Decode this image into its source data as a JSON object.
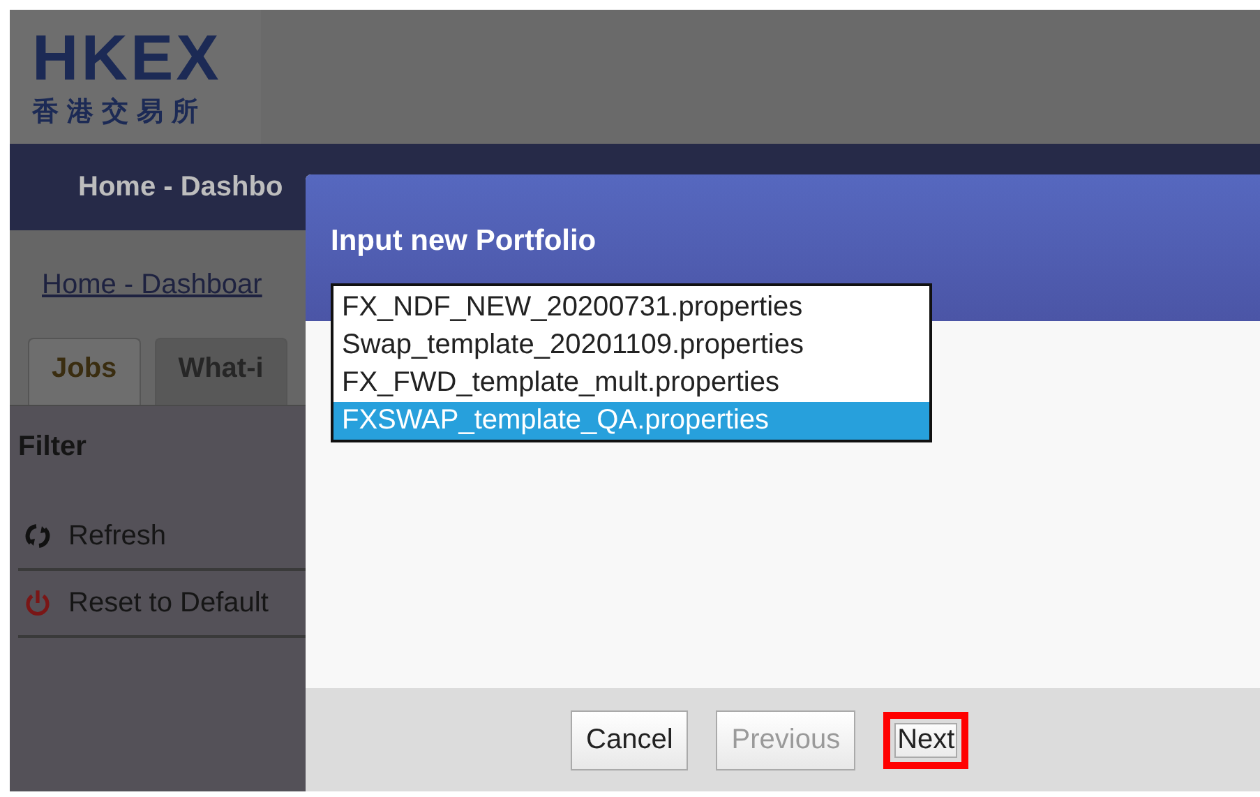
{
  "logo": {
    "name": "HKEX",
    "subtitle": "香港交易所"
  },
  "nav": {
    "title": "Home - Dashbo"
  },
  "breadcrumb": "Home - Dashboar",
  "tabs": [
    {
      "label": "Jobs",
      "selected": true
    },
    {
      "label": "What-i",
      "selected": false
    }
  ],
  "sidebar": {
    "title": "Filter",
    "items": [
      {
        "label": "Refresh",
        "kind": "refresh"
      },
      {
        "label": "Reset to Default",
        "kind": "power"
      }
    ]
  },
  "dialog": {
    "title": "Input new Portfolio",
    "templates": [
      {
        "label": "FX_NDF_NEW_20200731.properties",
        "selected": false
      },
      {
        "label": "Swap_template_20201109.properties",
        "selected": false
      },
      {
        "label": "FX_FWD_template_mult.properties",
        "selected": false
      },
      {
        "label": "FXSWAP_template_QA.properties",
        "selected": true
      }
    ],
    "buttons": [
      {
        "label": "Cancel",
        "disabled": false,
        "highlighted": false
      },
      {
        "label": "Previous",
        "disabled": true,
        "highlighted": false
      },
      {
        "label": "Next",
        "disabled": false,
        "highlighted": true
      }
    ]
  }
}
